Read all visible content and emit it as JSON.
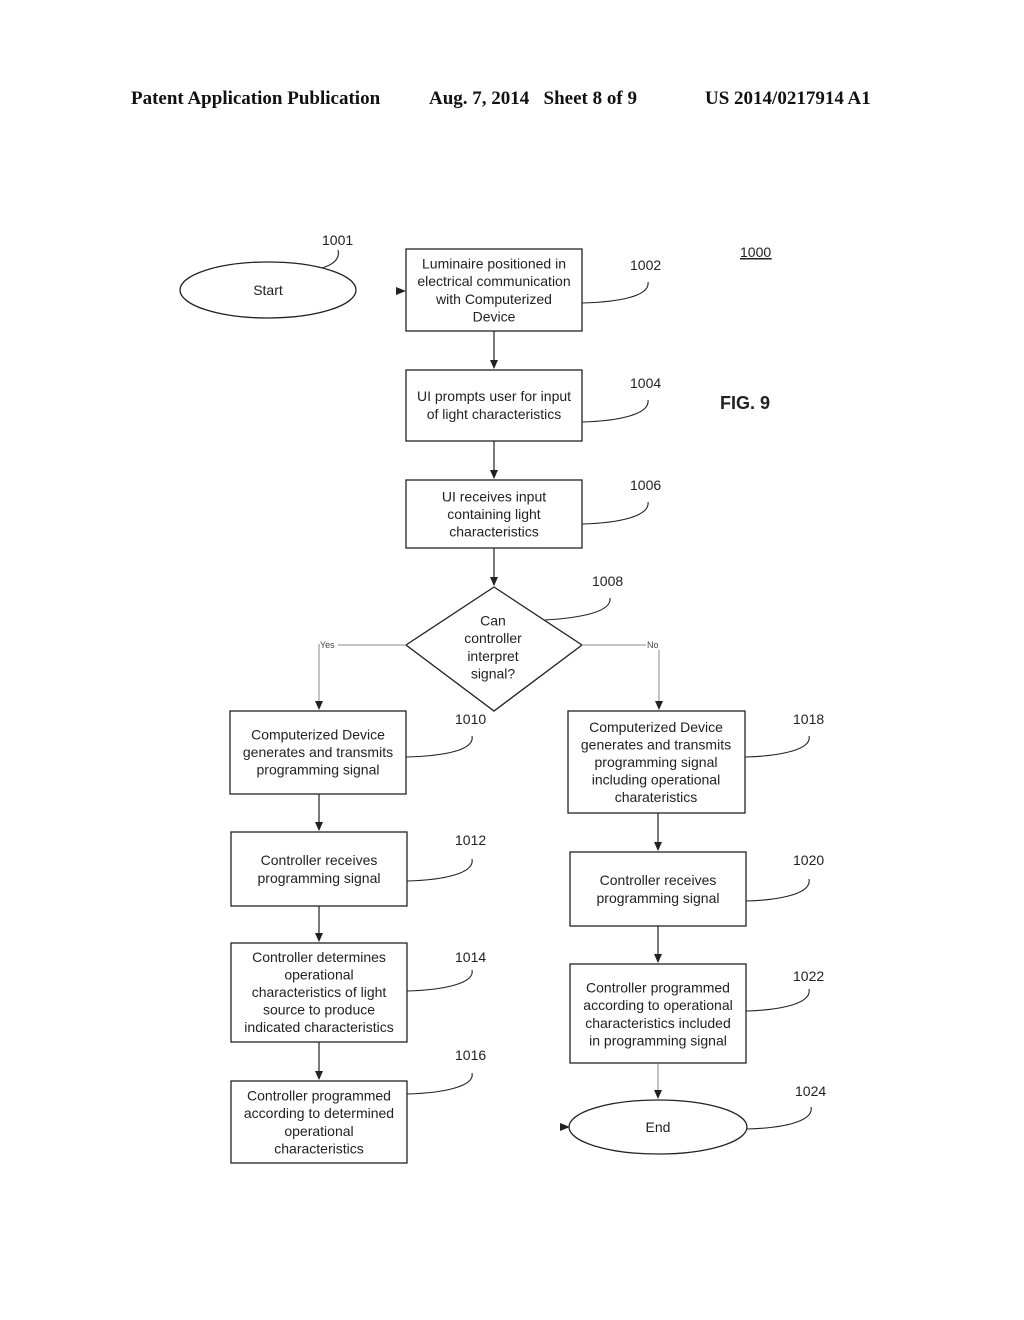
{
  "header": {
    "publication": "Patent Application Publication",
    "date_sheet": "Aug. 7, 2014   Sheet 8 of 9",
    "number": "US 2014/0217914 A1"
  },
  "figure": {
    "label": "FIG. 9",
    "ref": "1000"
  },
  "nodes": {
    "n1001": {
      "ref": "1001",
      "lines": [
        "Start"
      ]
    },
    "n1002": {
      "ref": "1002",
      "lines": [
        "Luminaire positioned in",
        "electrical communication",
        "with Computerized",
        "Device"
      ]
    },
    "n1004": {
      "ref": "1004",
      "lines": [
        "UI prompts user for input",
        "of light characteristics"
      ]
    },
    "n1006": {
      "ref": "1006",
      "lines": [
        "UI receives input",
        "containing light",
        "characteristics"
      ]
    },
    "n1008": {
      "ref": "1008",
      "lines": [
        "Can",
        "controller",
        "interpret",
        "signal?"
      ]
    },
    "n1010": {
      "ref": "1010",
      "lines": [
        "Computerized Device",
        "generates and transmits",
        "programming signal"
      ]
    },
    "n1012": {
      "ref": "1012",
      "lines": [
        "Controller receives",
        "programming signal"
      ]
    },
    "n1014": {
      "ref": "1014",
      "lines": [
        "Controller determines",
        "operational",
        "characteristics of light",
        "source to produce",
        "indicated characteristics"
      ]
    },
    "n1016": {
      "ref": "1016",
      "lines": [
        "Controller programmed",
        "according to determined",
        "operational",
        "characteristics"
      ]
    },
    "n1018": {
      "ref": "1018",
      "lines": [
        "Computerized Device",
        "generates and transmits",
        "programming signal",
        "including operational",
        "charateristics"
      ]
    },
    "n1020": {
      "ref": "1020",
      "lines": [
        "Controller receives",
        "programming signal"
      ]
    },
    "n1022": {
      "ref": "1022",
      "lines": [
        "Controller programmed",
        "according to operational",
        "characteristics included",
        "in programming signal"
      ]
    },
    "n1024": {
      "ref": "1024",
      "lines": [
        "End"
      ]
    }
  },
  "branches": {
    "yes": "Yes",
    "no": "No"
  }
}
